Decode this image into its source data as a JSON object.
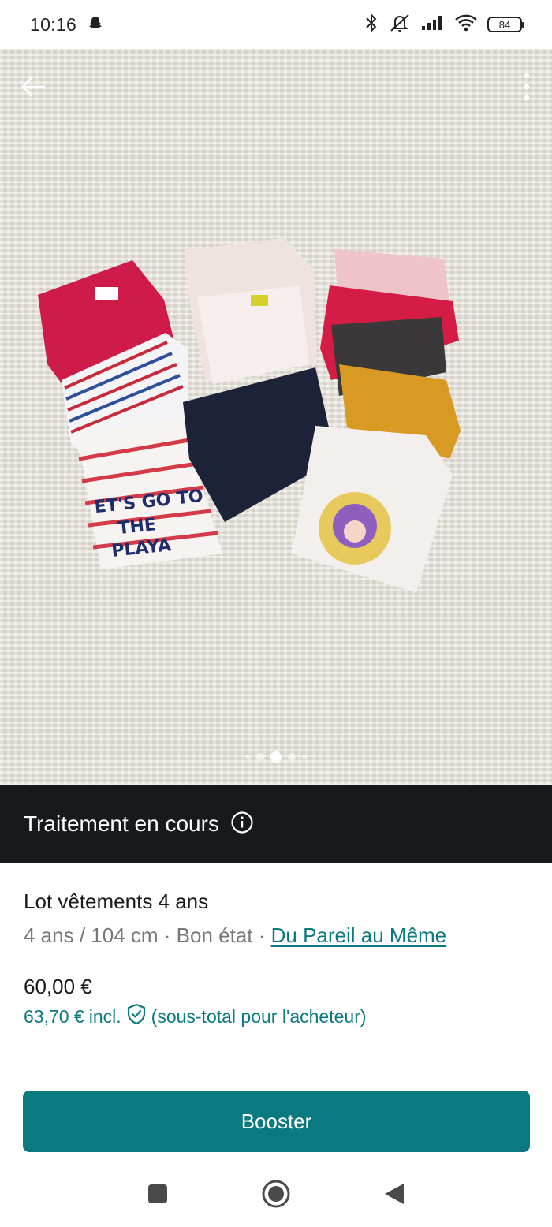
{
  "status_bar": {
    "time": "10:16",
    "battery": "84",
    "icons": [
      "snapchat-icon",
      "bluetooth-icon",
      "mute-icon",
      "signal-icon",
      "wifi-icon",
      "battery-icon"
    ]
  },
  "photo": {
    "page_dots": 5,
    "active_dot": 2,
    "icons": [
      "back-arrow-icon",
      "more-vert-icon"
    ]
  },
  "banner": {
    "text": "Traitement en cours",
    "icon": "info-icon"
  },
  "item": {
    "title": "Lot vêtements 4 ans",
    "meta_prefix": "4 ans / 104 cm · Bon état · ",
    "brand": "Du Pareil au Même",
    "price": "60,00 €",
    "buyer_price": "63,70 €",
    "buyer_incl": "incl.",
    "buyer_note": "(sous-total pour l'acheteur)",
    "shield_icon": "shield-check-icon"
  },
  "actions": {
    "booster_label": "Booster"
  },
  "nav": {
    "icons": [
      "recents-icon",
      "home-icon",
      "back-triangle-icon"
    ]
  },
  "colors": {
    "accent": "#0b7a80",
    "banner_bg": "#161a1d"
  }
}
